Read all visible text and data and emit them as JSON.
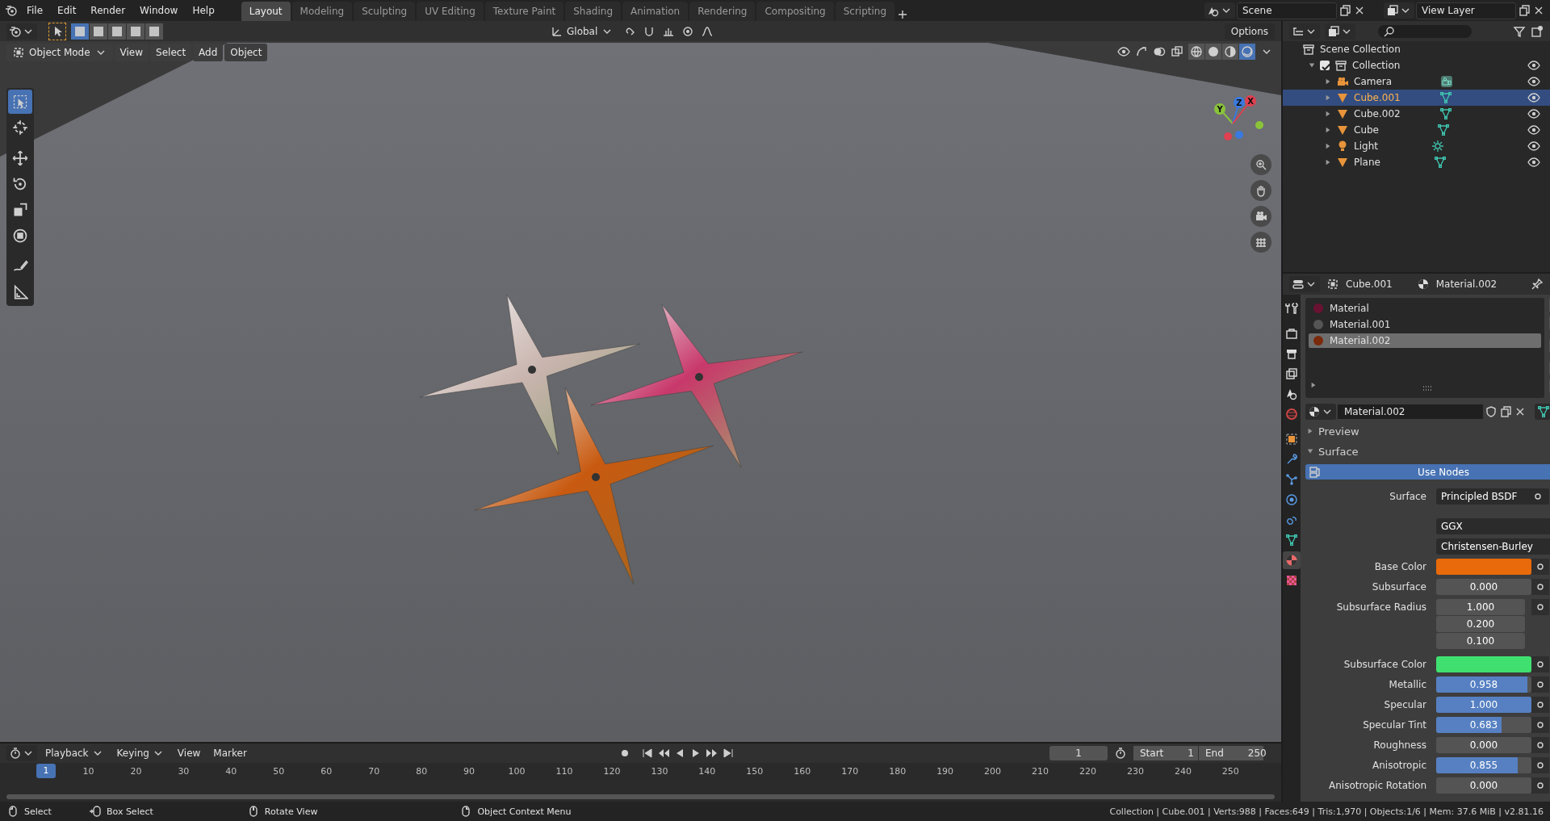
{
  "menu": [
    "File",
    "Edit",
    "Render",
    "Window",
    "Help"
  ],
  "workspaces": [
    {
      "label": "Layout",
      "selected": true
    },
    {
      "label": "Modeling",
      "selected": false
    },
    {
      "label": "Sculpting",
      "selected": false
    },
    {
      "label": "UV Editing",
      "selected": false
    },
    {
      "label": "Texture Paint",
      "selected": false
    },
    {
      "label": "Shading",
      "selected": false
    },
    {
      "label": "Animation",
      "selected": false
    },
    {
      "label": "Rendering",
      "selected": false
    },
    {
      "label": "Compositing",
      "selected": false
    },
    {
      "label": "Scripting",
      "selected": false
    }
  ],
  "scene": {
    "name": "Scene"
  },
  "view_layer": {
    "name": "View Layer"
  },
  "tool_header": {
    "select_modes": [
      {
        "selected": true
      },
      {
        "selected": false
      },
      {
        "selected": false
      },
      {
        "selected": false
      },
      {
        "selected": false
      }
    ],
    "orientation": "Global",
    "options": "Options"
  },
  "viewport": {
    "mode": "Object Mode",
    "menus": [
      "View",
      "Select",
      "Add",
      "Object"
    ],
    "shading": [
      {
        "selected": false
      },
      {
        "selected": false
      },
      {
        "selected": false
      },
      {
        "selected": true
      }
    ],
    "tools": [
      {
        "kind": "select",
        "selected": true
      },
      {
        "kind": "cursor",
        "selected": false
      },
      {
        "kind": "move",
        "selected": false
      },
      {
        "kind": "rotate",
        "selected": false
      },
      {
        "kind": "scale",
        "selected": false
      },
      {
        "kind": "transform",
        "selected": false
      },
      {
        "kind": "annotate",
        "selected": false
      },
      {
        "kind": "measure",
        "selected": false
      }
    ],
    "axes": [
      "Y",
      "Z",
      "X"
    ]
  },
  "outliner": {
    "root": "Scene Collection",
    "items": [
      {
        "label": "Collection",
        "kind": "collection",
        "checked": true,
        "expanded": true,
        "selected": false,
        "children": [
          {
            "label": "Camera",
            "kind": "camera",
            "expanded": false,
            "selected": false
          },
          {
            "label": "Cube.001",
            "kind": "mesh",
            "expanded": false,
            "selected": true
          },
          {
            "label": "Cube.002",
            "kind": "mesh",
            "expanded": false,
            "selected": false
          },
          {
            "label": "Cube",
            "kind": "mesh",
            "expanded": false,
            "selected": false
          },
          {
            "label": "Light",
            "kind": "light",
            "expanded": false,
            "selected": false
          },
          {
            "label": "Plane",
            "kind": "mesh",
            "expanded": false,
            "selected": false
          }
        ]
      }
    ]
  },
  "properties": {
    "object": "Cube.001",
    "material": "Material.002",
    "tabs": [
      {
        "kind": "tool",
        "selected": false
      },
      {
        "kind": "render",
        "selected": false
      },
      {
        "kind": "output",
        "selected": false
      },
      {
        "kind": "view_layer",
        "selected": false
      },
      {
        "kind": "scene",
        "selected": false
      },
      {
        "kind": "world",
        "selected": false
      },
      {
        "kind": "object",
        "selected": false
      },
      {
        "kind": "modifier",
        "selected": false
      },
      {
        "kind": "particles",
        "selected": false
      },
      {
        "kind": "physics",
        "selected": false
      },
      {
        "kind": "constraints",
        "selected": false
      },
      {
        "kind": "data",
        "selected": false
      },
      {
        "kind": "material",
        "selected": true
      },
      {
        "kind": "texture",
        "selected": false
      }
    ],
    "slots": [
      {
        "name": "Material",
        "color": "#6a1232",
        "selected": false
      },
      {
        "name": "Material.001",
        "color": "#555555",
        "selected": false
      },
      {
        "name": "Material.002",
        "color": "#7a2a0a",
        "selected": true
      }
    ],
    "material_name": "Material.002",
    "panels": [
      {
        "label": "Preview",
        "expanded": false
      },
      {
        "label": "Surface",
        "expanded": true
      }
    ],
    "use_nodes": {
      "label": "Use Nodes",
      "on": true
    },
    "rows": [
      {
        "kind": "dropdown",
        "label": "Surface",
        "value": "Principled BSDF"
      },
      {
        "kind": "menu",
        "value": "GGX"
      },
      {
        "kind": "menu",
        "value": "Christensen-Burley"
      },
      {
        "kind": "color",
        "label": "Base Color",
        "color": "#e86a0a"
      },
      {
        "kind": "slider",
        "label": "Subsurface",
        "value": "0.000",
        "level": 0
      },
      {
        "kind": "vector",
        "label": "Subsurface Radius",
        "values": [
          "1.000",
          "0.200",
          "0.100"
        ]
      },
      {
        "kind": "color",
        "label": "Subsurface Color",
        "color": "#40e070"
      },
      {
        "kind": "slider",
        "label": "Metallic",
        "value": "0.958",
        "level": 0.958
      },
      {
        "kind": "slider",
        "label": "Specular",
        "value": "1.000",
        "level": 1
      },
      {
        "kind": "slider",
        "label": "Specular Tint",
        "value": "0.683",
        "level": 0.683
      },
      {
        "kind": "slider",
        "label": "Roughness",
        "value": "0.000",
        "level": 0
      },
      {
        "kind": "slider",
        "label": "Anisotropic",
        "value": "0.855",
        "level": 0.855
      },
      {
        "kind": "slider",
        "label": "Anisotropic Rotation",
        "value": "0.000",
        "level": 0
      }
    ]
  },
  "timeline": {
    "menus": [
      "Playback",
      "Keying",
      "View",
      "Marker"
    ],
    "current_frame": "1",
    "start_label": "Start",
    "start": "1",
    "end_label": "End",
    "end": "250",
    "ruler_current": "1",
    "ruler": [
      "10",
      "20",
      "30",
      "40",
      "50",
      "60",
      "70",
      "80",
      "90",
      "100",
      "110",
      "120",
      "130",
      "140",
      "150",
      "160",
      "170",
      "180",
      "190",
      "200",
      "210",
      "220",
      "230",
      "240",
      "250"
    ]
  },
  "status_bar": {
    "hints": [
      {
        "kind": "left",
        "label": "Select"
      },
      {
        "kind": "drag",
        "label": "Box Select"
      },
      {
        "kind": "middle",
        "label": "Rotate View"
      },
      {
        "kind": "right",
        "label": "Object Context Menu"
      }
    ],
    "stats": "Collection | Cube.001 | Verts:988 | Faces:649 | Tris:1,970 | Objects:1/6 | Mem: 37.6 MiB | v2.81.16"
  }
}
